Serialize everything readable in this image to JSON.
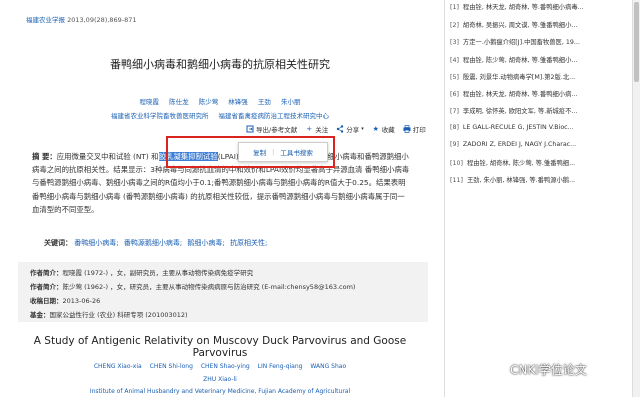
{
  "journal": {
    "name": "福建农业学报",
    "info": "2013,09(28),869-871"
  },
  "paper": {
    "title_cn": "番鸭细小病毒和鹅细小病毒的抗原相关性研究",
    "authors_cn": [
      "程晓霞",
      "陈仕龙",
      "陈少莺",
      "林锋强",
      "王劲",
      "朱小丽"
    ],
    "affiliations_cn": [
      "福建省农业科学院畜牧兽医研究所",
      "福建省畜禽疫病防治工程技术研究中心"
    ]
  },
  "toolbar": {
    "export": "导出/参考文献",
    "follow": "关注",
    "share": "分享",
    "favorite": "收藏",
    "print": "打印"
  },
  "abstract": {
    "label": "摘 要：",
    "text_before": "应用微量交叉中和试验 (NT) 和",
    "highlight": "胶乳凝集抑制试验",
    "text_after": "(LPAI)，研究了番鸭细小病毒和鹅细小病毒和番鸭源鹅细小病毒之间的抗原相关性。结果显示：3种病毒与同源抗血清的中和效价和LPAI效价均显著高于异源血清 番鸭细小病毒与番鸭源鹅细小病毒、鹅细小病毒之间的R值均小于0.1;番鸭源鹅细小病毒与鹅细小病毒的R值大于0.25。结果表明番鸭细小病毒与鹅细小病毒 (番鸭源鹅细小病毒) 的抗原相关性较低，提示番鸭源鹅细小病毒与鹅细小病毒属于同一血清型的不同亚型。"
  },
  "popup": {
    "copy": "复制",
    "search": "工具书搜索"
  },
  "keywords": {
    "label": "关键词：",
    "items": [
      "番鸭细小病毒;",
      "番鸭源鹅细小病毒;",
      "鹅细小病毒;",
      "抗原相关性;"
    ]
  },
  "meta": {
    "author1_label": "作者简介：",
    "author1": "程晓霞 (1972-) ，女，副研究员，主要从事动物传染病免疫学研究",
    "author2_label": "作者简介：",
    "author2": "陈少莺 (1962-) ，女，研究员，主要从事动物传染病病原与防治研究 (E-mail:chensy58@163.com)",
    "received_label": "收稿日期：",
    "received": "2013-06-26",
    "fund_label": "基金：",
    "fund": "国家公益性行业 (农业) 科研专项 (201003012)"
  },
  "english": {
    "title": "A Study of Antigenic Relativity on Muscovy Duck Parvovirus and Goose Parvovirus",
    "authors": [
      "CHENG Xiao-xia",
      "CHEN Shi-long",
      "CHEN Shao-ying",
      "LIN Feng-qiang",
      "WANG Shao"
    ],
    "zhu": "ZHU Xiao-li",
    "affiliation": "Institute of Animal Husbandry and Veterinary Medicine, Fujian Academy of Agricultural"
  },
  "references": [
    {
      "num": "[1]",
      "text": "程由铨, 林天龙, 胡奇林, 等.番鸭细小病毒..."
    },
    {
      "num": "[2]",
      "text": "胡奇林, 吴振兴, 周文谟, 等.雏番鸭细小..."
    },
    {
      "num": "[3]",
      "text": "方定一.小鹅瘟介绍[J].中国畜牧兽医, 19..."
    },
    {
      "num": "[4]",
      "text": "程由铨, 陈少莺, 胡奇林, 等.雏番鸭细小..."
    },
    {
      "num": "[5]",
      "text": "殷震, 刘景华.动物病毒学[M].第2版.北..."
    },
    {
      "num": "[6]",
      "text": "程由铨, 林天龙, 胡奇林, 等.番鸭细小病..."
    },
    {
      "num": "[7]",
      "text": "李成明, 徐怀英, 欧阳文军, 等.新城疫不..."
    },
    {
      "num": "[8]",
      "text": "LE GALL-RECULE G, JESTIN V.Bioc..."
    },
    {
      "num": "[9]",
      "text": "ZADORI Z, ERDEI J, NAGY J.Charac..."
    },
    {
      "num": "[10]",
      "text": "程由铨, 胡奇林, 陈少莺, 等.雏番鸭细..."
    },
    {
      "num": "[11]",
      "text": "王劲, 朱小丽, 林锋强, 等.番鸭源小鹅..."
    }
  ],
  "watermark": "CNKI学位论文"
}
